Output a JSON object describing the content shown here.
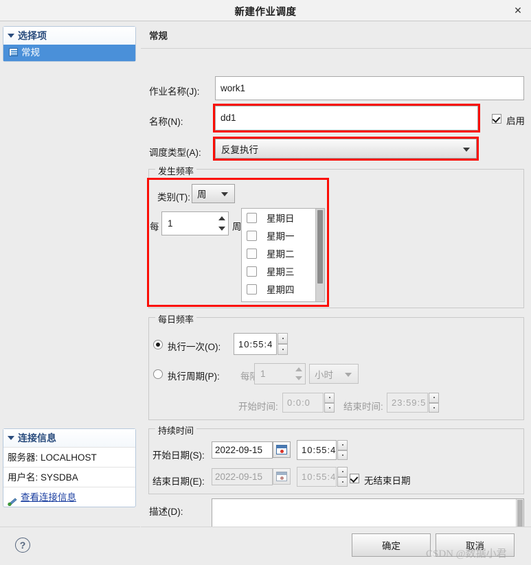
{
  "window": {
    "title": "新建作业调度",
    "close_label": "✕"
  },
  "sidebar": {
    "options_panel": {
      "title": "选择项",
      "items": [
        {
          "label": "常规",
          "icon": "grid-icon",
          "selected": true
        }
      ]
    },
    "connection_panel": {
      "title": "连接信息",
      "rows": [
        {
          "label": "服务器:",
          "value": "LOCALHOST"
        },
        {
          "label": "用户名:",
          "value": "SYSDBA"
        }
      ],
      "link": "查看连接信息"
    },
    "help_icon": "?"
  },
  "content": {
    "section_title": "常规",
    "job_name": {
      "label": "作业名称(J):",
      "value": "work1",
      "placeholder": ""
    },
    "name": {
      "label": "名称(N):",
      "value": "dd1",
      "highlighted": true
    },
    "enabled": {
      "label": "启用",
      "checked": true
    },
    "schedule_type": {
      "label": "调度类型(A):",
      "value": "反复执行",
      "highlighted": true
    },
    "frequency_group": {
      "title": "发生频率",
      "category": {
        "label": "类别(T):",
        "value": "周"
      },
      "interval": {
        "prefix_label": "每",
        "value": "1",
        "suffix_label": "周"
      },
      "weekdays": [
        {
          "label": "星期日",
          "checked": false
        },
        {
          "label": "星期一",
          "checked": false
        },
        {
          "label": "星期二",
          "checked": false
        },
        {
          "label": "星期三",
          "checked": false
        },
        {
          "label": "星期四",
          "checked": false
        }
      ]
    },
    "daily_group": {
      "title": "每日频率",
      "once": {
        "label": "执行一次(O):",
        "selected": true,
        "time": "10:55:4"
      },
      "periodic": {
        "label": "执行周期(P):",
        "selected": false,
        "every_label": "每隔",
        "every_value": "1",
        "unit": "小时"
      },
      "start_time": {
        "label": "开始时间:",
        "value": "0:0:0"
      },
      "end_time": {
        "label": "结束时间:",
        "value": "23:59:5"
      }
    },
    "duration_group": {
      "title": "持续时间",
      "start_date": {
        "label": "开始日期(S):",
        "value": "2022-09-15",
        "time": "10:55:4"
      },
      "end_date": {
        "label": "结束日期(E):",
        "value": "2022-09-15",
        "time": "10:55:4"
      },
      "no_end_date": {
        "label": "无结束日期",
        "checked": true
      }
    },
    "description": {
      "label": "描述(D):",
      "value": ""
    }
  },
  "footer": {
    "ok_label": "确定",
    "cancel_label": "取消"
  },
  "watermark": "CSDN @数据小君",
  "colors": {
    "highlight_red": "#fb0d05",
    "selection_blue": "#4a90d9",
    "panel_header_blue": "#2a4c7d",
    "link_blue": "#1b3fa0"
  }
}
